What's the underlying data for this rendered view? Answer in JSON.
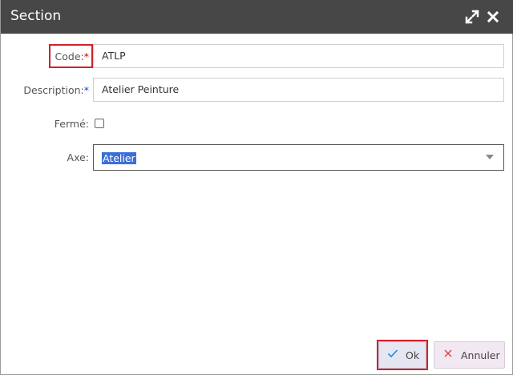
{
  "dialog": {
    "title": "Section",
    "icons": {
      "maximize": "expand-arrows-icon",
      "close": "close-x-icon"
    }
  },
  "form": {
    "code": {
      "label": "Code:",
      "required_mark": "*",
      "value": "ATLP"
    },
    "description": {
      "label": "Description:",
      "required_mark": "*",
      "value": "Atelier Peinture"
    },
    "ferme": {
      "label": "Fermé:",
      "checked": false
    },
    "axe": {
      "label": "Axe:",
      "selected": "Atelier"
    }
  },
  "buttons": {
    "ok": {
      "label": "Ok",
      "icon": "check-icon"
    },
    "cancel": {
      "label": "Annuler",
      "icon": "x-icon"
    }
  },
  "colors": {
    "titlebar": "#474747",
    "required_red": "#cc0000",
    "required_blue": "#1a3fd0",
    "highlight_red": "#d0202a",
    "selection_blue": "#3a6fd8"
  }
}
